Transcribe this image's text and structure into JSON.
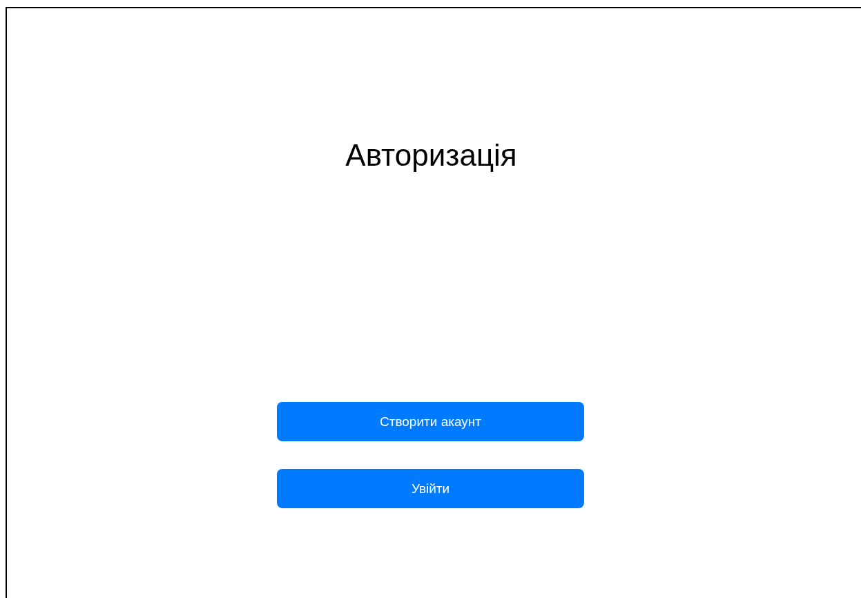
{
  "title": "Авторизація",
  "buttons": [
    {
      "label": "Створити акаунт"
    },
    {
      "label": "Увійти"
    }
  ]
}
